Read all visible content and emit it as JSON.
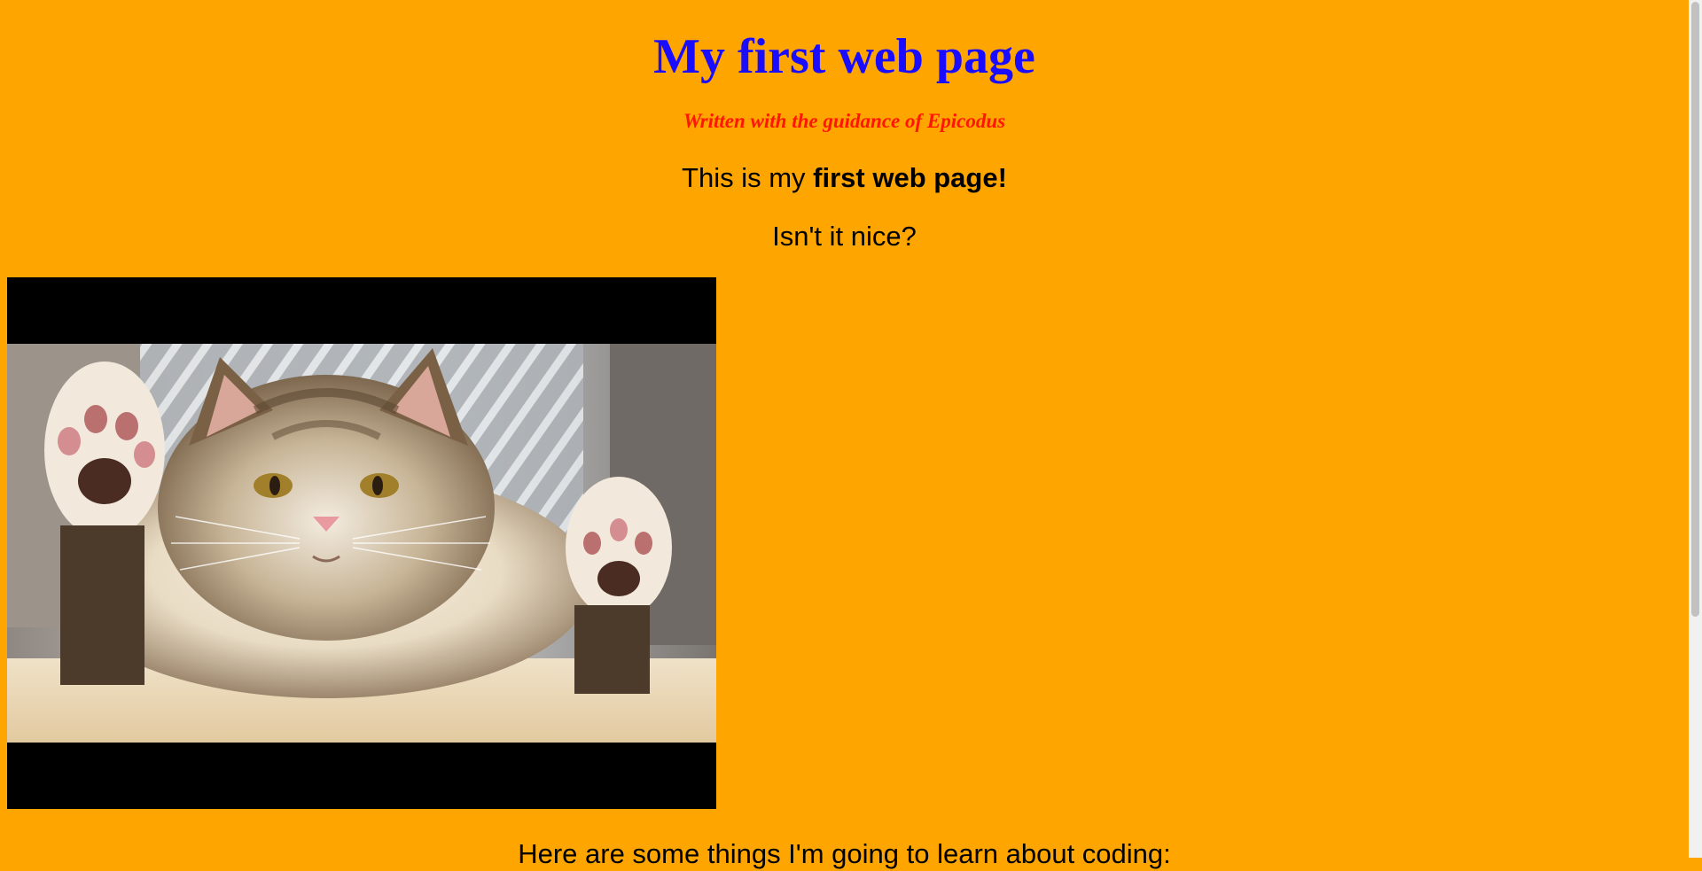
{
  "page": {
    "title": "My first web page",
    "subtitle": "Written with the guidance of Epicodus",
    "intro_prefix": "This is my ",
    "intro_bold": "first web page!",
    "question": "Isn't it nice?",
    "learn_heading": "Here are some things I'm going to learn about coding:"
  },
  "image": {
    "subject": "cat photo",
    "alt": ""
  },
  "colors": {
    "background": "#FFA500",
    "title": "#1a0dff",
    "subtitle": "#ff1500",
    "text": "#000000"
  }
}
